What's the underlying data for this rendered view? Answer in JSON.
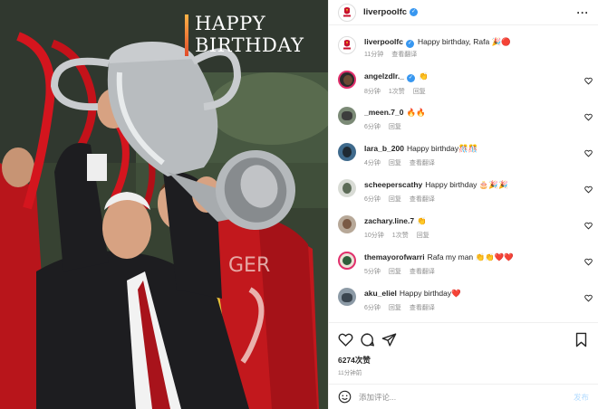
{
  "photo": {
    "headline_line1": "HAPPY",
    "headline_line2": "BIRTHDAY",
    "accent": "#e14b2a"
  },
  "header": {
    "username": "liverpoolfc",
    "more_icon": "more-horizontal-icon"
  },
  "caption": {
    "username": "liverpoolfc",
    "text": "Happy birthday, Rafa 🎉🔴",
    "time": "11分钟",
    "translate": "查看翻译"
  },
  "comments": [
    {
      "username": "angelzdlr._",
      "text": "👏",
      "time": "8分钟",
      "likes": "1次赞",
      "reply": "回复"
    },
    {
      "username": "_meen.7_0",
      "text": "🔥🔥",
      "time": "6分钟",
      "reply": "回复"
    },
    {
      "username": "lara_b_200",
      "text": "Happy birthday🎊🎊",
      "time": "4分钟",
      "reply": "回复",
      "translate": "查看翻译"
    },
    {
      "username": "scheeperscathy",
      "text": "Happy birthday 🎂🎉🎉",
      "time": "6分钟",
      "reply": "回复",
      "translate": "查看翻译"
    },
    {
      "username": "zachary.line.7",
      "text": "👏",
      "time": "10分钟",
      "likes": "1次赞",
      "reply": "回复"
    },
    {
      "username": "themayorofwarri",
      "text": "Rafa my man 👏👏❤️❤️",
      "time": "5分钟",
      "reply": "回复",
      "translate": "查看翻译"
    },
    {
      "username": "aku_eliel",
      "text": "Happy birthday❤️",
      "time": "6分钟",
      "reply": "回复",
      "translate": "查看翻译"
    }
  ],
  "actions": {
    "like_icon": "heart-icon",
    "comment_icon": "comment-icon",
    "share_icon": "share-icon",
    "save_icon": "bookmark-icon",
    "likes": "6274次赞",
    "posted": "11分钟前"
  },
  "composer": {
    "placeholder": "添加评论...",
    "post_label": "发布"
  },
  "colors": {
    "verified": "#3897f0",
    "muted": "#8e8e8e",
    "lfc_red": "#c8102e"
  }
}
